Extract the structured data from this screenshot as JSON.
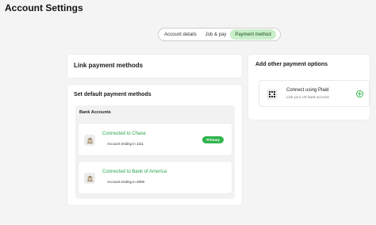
{
  "page_title": "Account Settings",
  "tabs": [
    {
      "label": "Account details",
      "active": false
    },
    {
      "label": "Job & pay",
      "active": false
    },
    {
      "label": "Payment method",
      "active": true
    }
  ],
  "link_card": {
    "title": "Link payment methods"
  },
  "default_card": {
    "title": "Set default payment methods",
    "section_title": "Bank Accounts",
    "banks": [
      {
        "name": "Connected to Chase",
        "account": "Account ending in 1111",
        "badge": "Primary",
        "icon": "bank-icon"
      },
      {
        "name": "Connected to Bank of America",
        "account": "Account ending in 2909",
        "icon": "bank-icon"
      }
    ]
  },
  "other_card": {
    "title": "Add other payment options",
    "plaid": {
      "title": "Connect using Plaid",
      "subtitle": "Link your US bank account",
      "icon": "plaid-icon",
      "action_icon": "add-circle-icon"
    }
  },
  "colors": {
    "accent_green": "#2fb44d",
    "active_tab_bg": "#c9efc9",
    "page_bg": "#f4f4f4"
  }
}
